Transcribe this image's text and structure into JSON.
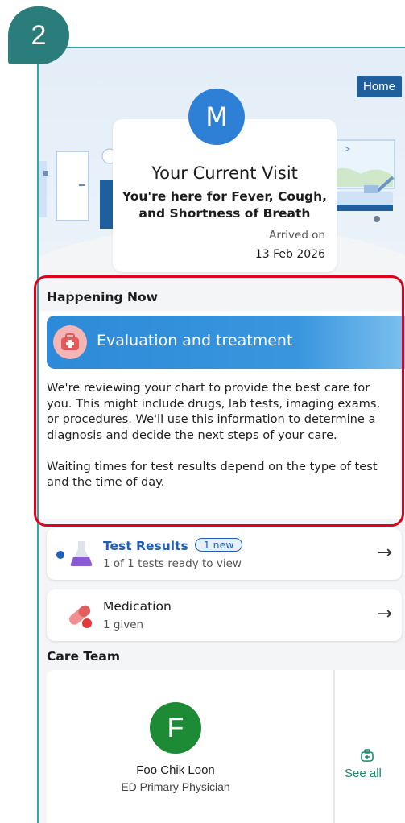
{
  "step_badge": "2",
  "header": {
    "home_label": "Home",
    "avatar_initial": "M",
    "visit_title": "Your Current Visit",
    "visit_reason": "You're here for Fever, Cough, and Shortness of Breath",
    "arrived_label": "Arrived on",
    "arrived_date": "13 Feb 2026"
  },
  "happening_now": {
    "section_title": "Happening Now",
    "banner_title": "Evaluation and treatment",
    "paragraph_1": "We're reviewing your chart to provide the best care for you. This might include drugs, lab tests, imaging exams, or procedures. We'll use this information to determine a diagnosis and decide the next steps of your care.",
    "paragraph_2": "Waiting times for test results depend on the type of test and the time of day."
  },
  "test_results": {
    "title": "Test Results",
    "badge": "1 new",
    "subtitle": "1 of 1 tests ready to view"
  },
  "medication": {
    "title": "Medication",
    "subtitle": "1 given"
  },
  "care_team": {
    "section_title": "Care Team",
    "member_initial": "F",
    "member_name": "Foo Chik Loon",
    "member_role": "ED Primary Physician",
    "see_all_label": "See all"
  },
  "colors": {
    "accent_teal": "#2a7d7a",
    "banner_blue": "#2c8ad8",
    "avatar_blue": "#2e7fd6",
    "care_avatar_green": "#1d8a35",
    "highlight_red": "#e0001b"
  }
}
